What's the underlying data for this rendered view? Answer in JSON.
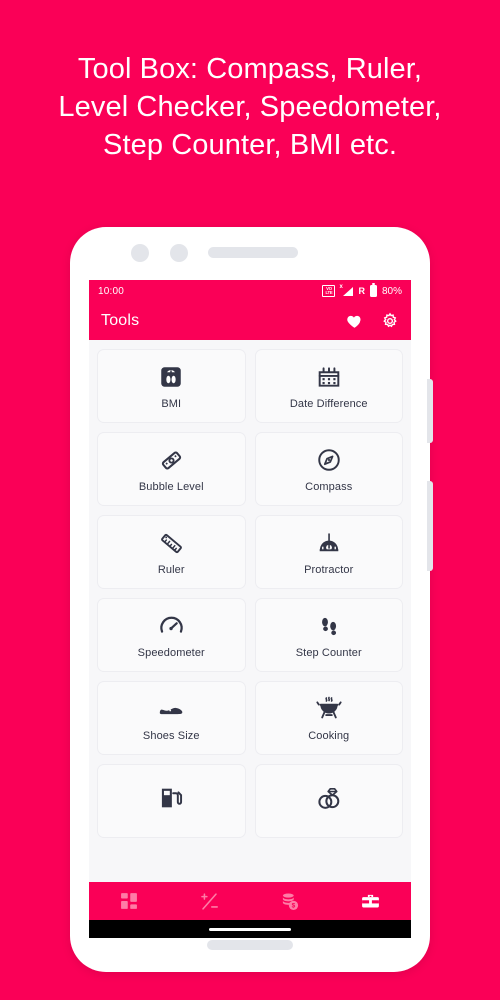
{
  "headline": {
    "line1": "Tool Box: Compass, Ruler,",
    "line2": "Level Checker, Speedometer,",
    "line3": "Step Counter, BMI etc."
  },
  "colors": {
    "brand_pink": "#FA0057",
    "tile_bg": "#FAFAFB",
    "icon_navy": "#333647",
    "frame_white": "#FFFFFF",
    "bezel_grey": "#E3E5EA"
  },
  "phone": {
    "status_bar": {
      "time": "10:00",
      "volte_top": "VO",
      "volte_bottom": "LTE",
      "signal_x": "x",
      "roaming": "R",
      "battery_percent": "80%"
    },
    "app_bar": {
      "title": "Tools",
      "favorite_icon": "heart-icon",
      "settings_icon": "gear-icon"
    },
    "tools": [
      {
        "label": "BMI",
        "icon": "scale-icon"
      },
      {
        "label": "Date Difference",
        "icon": "calendar-icon"
      },
      {
        "label": "Bubble Level",
        "icon": "bubble-level-icon"
      },
      {
        "label": "Compass",
        "icon": "compass-icon"
      },
      {
        "label": "Ruler",
        "icon": "ruler-icon"
      },
      {
        "label": "Protractor",
        "icon": "protractor-icon"
      },
      {
        "label": "Speedometer",
        "icon": "speedometer-icon"
      },
      {
        "label": "Step Counter",
        "icon": "footprints-icon"
      },
      {
        "label": "Shoes Size",
        "icon": "shoe-icon"
      },
      {
        "label": "Cooking",
        "icon": "grill-icon"
      },
      {
        "label": "",
        "icon": "fuel-pump-icon"
      },
      {
        "label": "",
        "icon": "wedding-rings-icon"
      }
    ],
    "bottom_nav": [
      {
        "icon": "grid-icon",
        "active": false
      },
      {
        "icon": "plus-minus-icon",
        "active": false
      },
      {
        "icon": "money-coins-icon",
        "active": false
      },
      {
        "icon": "toolbox-icon",
        "active": true
      }
    ]
  }
}
